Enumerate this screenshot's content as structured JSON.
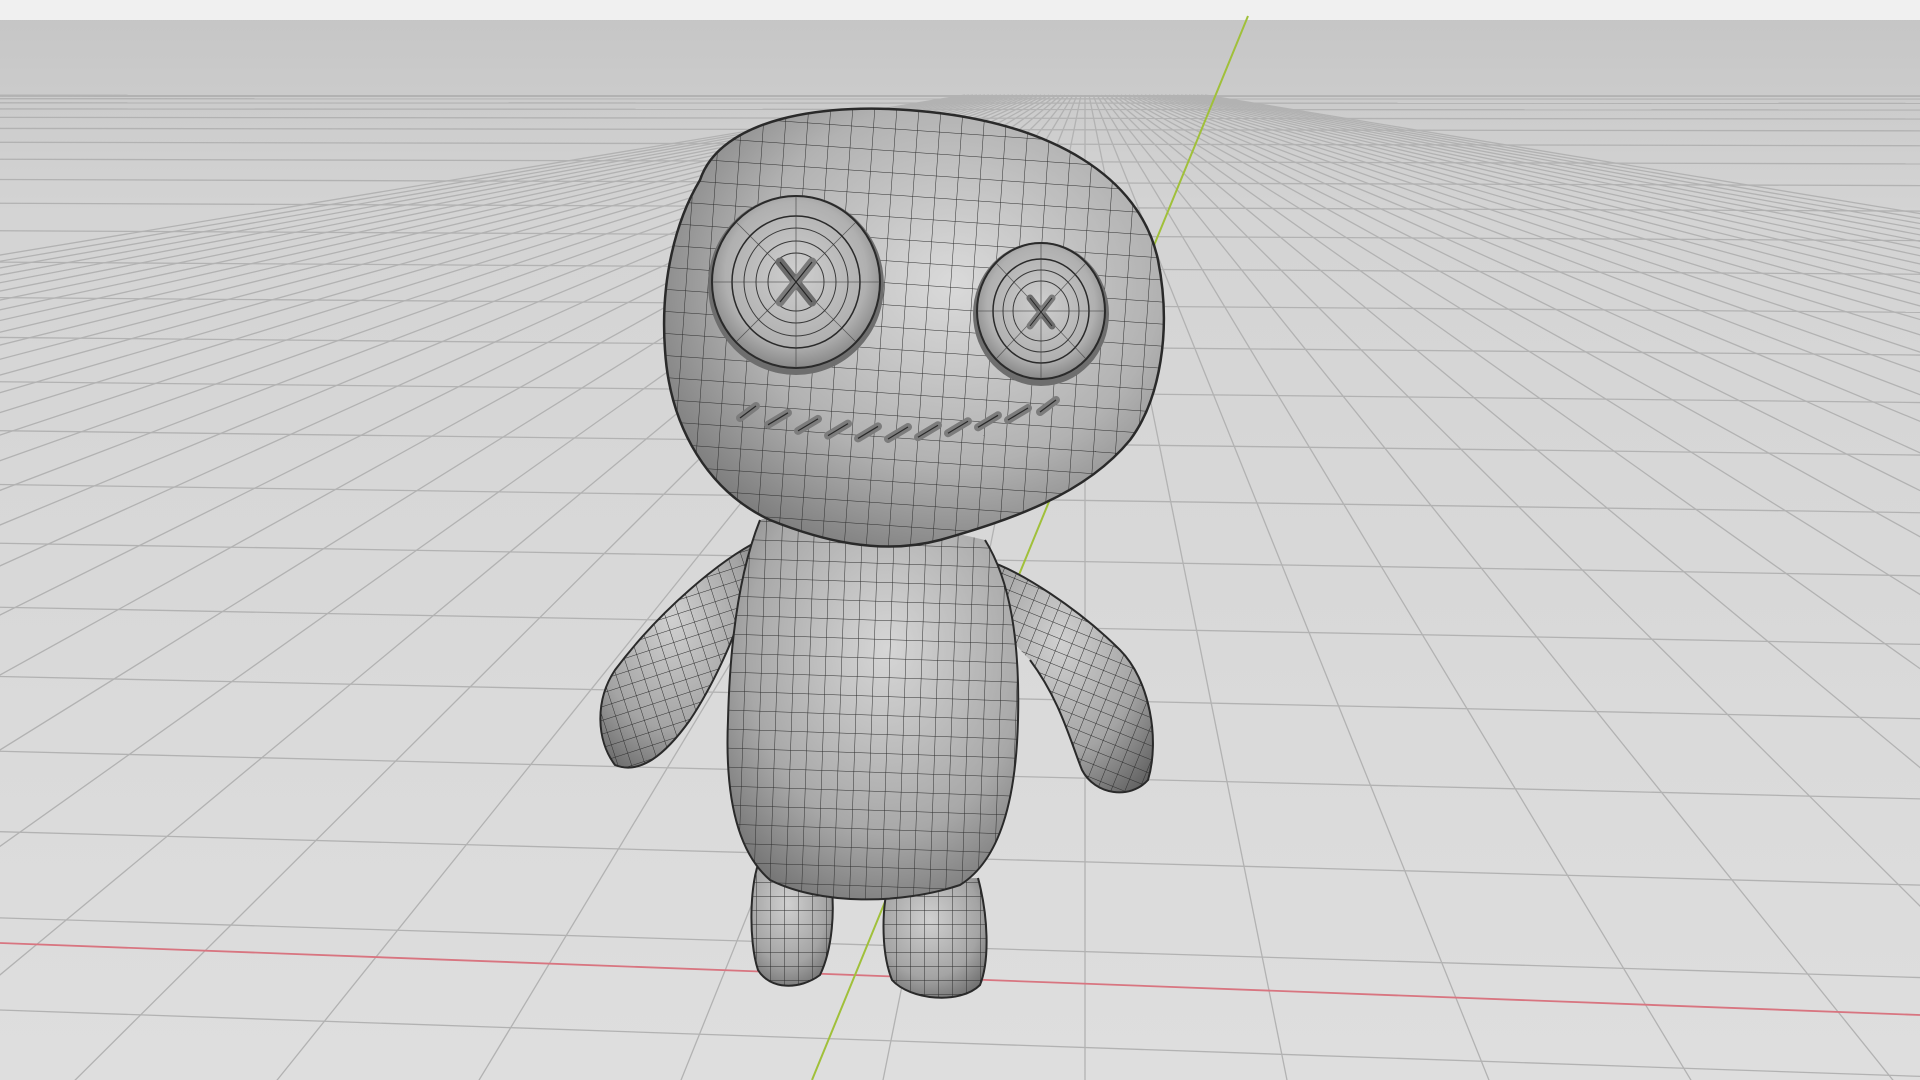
{
  "scene": {
    "background_top": "#c4c4c4",
    "background_bottom": "#dedede",
    "floor_grid_color": "#b2b2b2",
    "axis_x_color": "#d6707a",
    "axis_y_color": "#9bbd3c",
    "mesh_fill": "#9a9a9a",
    "mesh_highlight": "#d8d8d8",
    "mesh_shadow": "#5e5e5e",
    "wireframe_color": "#2b2b2b"
  },
  "model": {
    "subject": "voodoo-doll",
    "parts": [
      "head",
      "left-eye-button",
      "right-eye-button",
      "stitched-mouth",
      "body",
      "left-arm",
      "right-arm",
      "left-leg",
      "right-leg"
    ],
    "mouth_stitch_count": 11,
    "wireframe_visible": true
  },
  "viewport": {
    "grid_visible": true,
    "axes_visible": true,
    "ui_text": []
  }
}
